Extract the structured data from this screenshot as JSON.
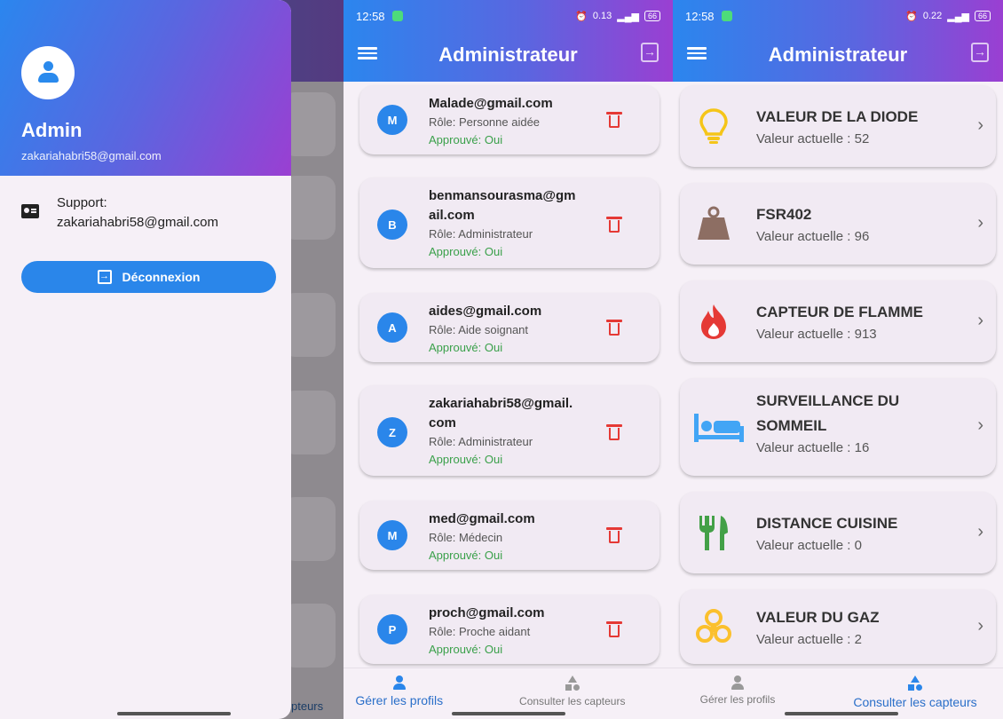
{
  "status_bar": {
    "time": "12:58",
    "speed1": "0.13",
    "speed2": "0.22",
    "battery": "66"
  },
  "app_title": "Administrateur",
  "drawer": {
    "name": "Admin",
    "email": "zakariahabri58@gmail.com",
    "support_label": "Support:",
    "support_email": "zakariahabri58@gmail.com",
    "logout_label": "Déconnexion",
    "nav_clip": "pteurs"
  },
  "profiles": [
    {
      "initial": "M",
      "email": "Malade@gmail.com",
      "role": "Rôle: Personne aidée",
      "approved": "Approuvé: Oui"
    },
    {
      "initial": "B",
      "email": "benmansourasma@gmail.com",
      "role": "Rôle: Administrateur",
      "approved": "Approuvé: Oui"
    },
    {
      "initial": "A",
      "email": "aides@gmail.com",
      "role": "Rôle: Aide soignant",
      "approved": "Approuvé: Oui"
    },
    {
      "initial": "Z",
      "email": "zakariahabri58@gmail.com",
      "role": "Rôle: Administrateur",
      "approved": "Approuvé: Oui"
    },
    {
      "initial": "M",
      "email": "med@gmail.com",
      "role": "Rôle: Médecin",
      "approved": "Approuvé: Oui"
    },
    {
      "initial": "P",
      "email": "proch@gmail.com",
      "role": "Rôle: Proche aidant",
      "approved": "Approuvé: Oui"
    }
  ],
  "sensors": [
    {
      "title": "VALEUR DE LA DIODE",
      "value": "Valeur actuelle : 52",
      "icon": "lightbulb-icon",
      "color": "#f5c518"
    },
    {
      "title": "FSR402",
      "value": "Valeur actuelle : 96",
      "icon": "weight-icon",
      "color": "#8d6e63"
    },
    {
      "title": "CAPTEUR DE FLAMME",
      "value": "Valeur actuelle : 913",
      "icon": "flame-icon",
      "color": "#e53935"
    },
    {
      "title": "SURVEILLANCE DU SOMMEIL",
      "value": "Valeur actuelle : 16",
      "icon": "bed-icon",
      "color": "#42a5f5"
    },
    {
      "title": "DISTANCE CUISINE",
      "value": "Valeur actuelle : 0",
      "icon": "restaurant-icon",
      "color": "#43a047"
    },
    {
      "title": "VALEUR DU GAZ",
      "value": "Valeur actuelle : 2",
      "icon": "biohazard-icon",
      "color": "#fbc02d"
    }
  ],
  "bottom_nav": {
    "profiles": "Gérer les profils",
    "sensors": "Consulter les capteurs"
  },
  "colors": {
    "primary": "#2a86ea",
    "accent_purple": "#9a3fd2",
    "approved": "#3aa04a",
    "delete": "#e53935"
  }
}
